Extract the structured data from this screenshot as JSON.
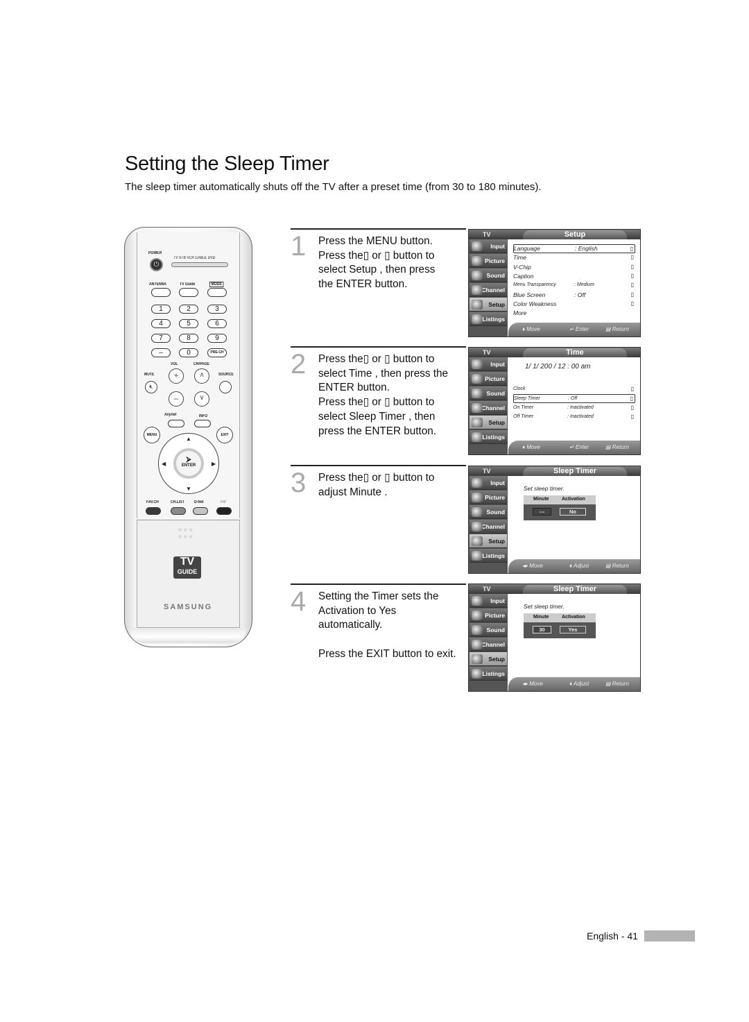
{
  "page": {
    "title": "Setting the Sleep Timer",
    "intro": "The sleep timer automatically shuts off the TV after a preset time (from 30 to 180 minutes).",
    "footer": "English - 41"
  },
  "remote": {
    "labels": {
      "power": "POWER",
      "modes": "TV  STB  VCR  CABLE  DVD",
      "antenna": "ANTENNA",
      "tv_guide": "TV Guide",
      "mode": "MODE",
      "pre_ch": "PRE-CH",
      "vol": "VOL",
      "ch_page": "CH/PAGE",
      "mute": "MUTE",
      "source": "SOURCE",
      "anynet": "Anynet",
      "info": "INFO",
      "menu": "MENU",
      "exit": "EXIT",
      "enter": "ENTER",
      "fav_ch": "FAV.CH",
      "ch_list": "CH.LIST",
      "d_net": "D-Net",
      "pip": "PIP",
      "brand": "SAMSUNG",
      "tvguide_top": "TV",
      "tvguide_bottom": "GUIDE"
    },
    "digits": [
      "1",
      "2",
      "3",
      "4",
      "5",
      "6",
      "7",
      "8",
      "9",
      "–",
      "0"
    ],
    "colors": {
      "fav_ch": "#3a3a3a",
      "ch_list": "#8a8a8a",
      "d_net": "#c4c4c4",
      "pip": "#222222"
    }
  },
  "steps": [
    {
      "number": "1",
      "text": "Press the MENU button.\nPress the▯  or ▯  button to\nselect  Setup , then press\nthe ENTER button."
    },
    {
      "number": "2",
      "text": "Press the▯  or ▯  button to\nselect  Time , then press the\nENTER button.\nPress the▯  or ▯  button to\nselect  Sleep Timer , then\npress the ENTER button."
    },
    {
      "number": "3",
      "text": "Press the▯  or ▯  button to\nadjust  Minute ."
    },
    {
      "number": "4",
      "text": "Setting the Timer sets the\nActivation to  Yes\nautomatically.\n\nPress the EXIT button to exit."
    }
  ],
  "tv_sidebar": [
    "Input",
    "Picture",
    "Sound",
    "Channel",
    "Setup",
    "Listings"
  ],
  "tv_logo": "TV",
  "screens": [
    {
      "title": "Setup",
      "active": "Setup",
      "rows": [
        {
          "label": "Language",
          "value": ": English",
          "arrow": "▯",
          "selected": true
        },
        {
          "label": "Time",
          "value": "",
          "arrow": "▯"
        },
        {
          "label": "V-Chip",
          "value": "",
          "arrow": "▯"
        },
        {
          "label": "Caption",
          "value": "",
          "arrow": "▯"
        },
        {
          "label": "Menu Transparency",
          "value": ": Medium",
          "arrow": "▯"
        },
        {
          "label": "Blue Screen",
          "value": ": Off",
          "arrow": "▯"
        },
        {
          "label": "Color Weakness",
          "value": "",
          "arrow": "▯"
        },
        {
          "label": "  More",
          "value": "",
          "arrow": ""
        }
      ],
      "footer": [
        "♦ Move",
        "↵ Enter",
        "▤ Return"
      ]
    },
    {
      "title": "Time",
      "active": "Setup",
      "date": "1/  1/ 200  / 12 : 00 am",
      "rows": [
        {
          "label": "Clock",
          "value": "",
          "arrow": "▯"
        },
        {
          "label": "Sleep Timer",
          "value": ": Off",
          "arrow": "▯",
          "selected": true
        },
        {
          "label": "On Timer",
          "value": ": Inactivated",
          "arrow": "▯"
        },
        {
          "label": "Off Timer",
          "value": ": Inactivated",
          "arrow": "▯"
        }
      ],
      "footer": [
        "♦ Move",
        "↵ Enter",
        "▤ Return"
      ]
    },
    {
      "title": "Sleep Timer",
      "active": "Setup",
      "note": "Set sleep timer.",
      "headers": [
        "Minute",
        "Activation"
      ],
      "minute": "---",
      "activation": "No",
      "footer": [
        "◂▸ Move",
        "♦ Adjust",
        "▤ Return"
      ]
    },
    {
      "title": "Sleep Timer",
      "active": "Setup",
      "note": "Set sleep timer.",
      "headers": [
        "Minute",
        "Activation"
      ],
      "minute": "30",
      "activation": "Yes",
      "footer": [
        "◂▸ Move",
        "♦ Adjust",
        "▤ Return"
      ]
    }
  ]
}
